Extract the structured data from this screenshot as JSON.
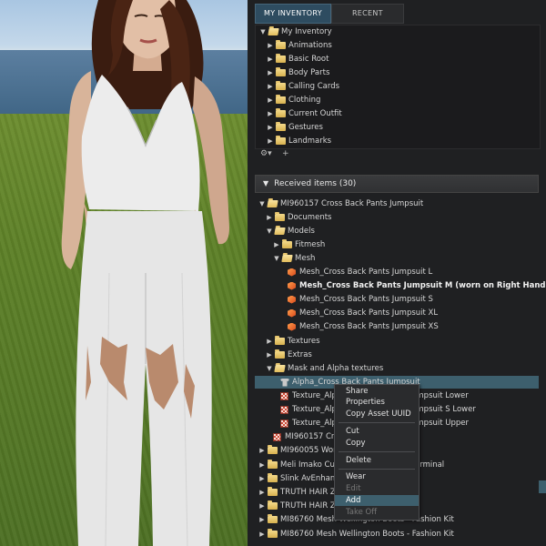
{
  "tabs": {
    "my_inventory": "MY INVENTORY",
    "recent": "RECENT"
  },
  "inventory_tree": [
    {
      "label": "My Inventory",
      "expanded": true
    },
    {
      "label": "Animations"
    },
    {
      "label": "Basic Root"
    },
    {
      "label": "Body Parts"
    },
    {
      "label": "Calling Cards"
    },
    {
      "label": "Clothing"
    },
    {
      "label": "Current Outfit"
    },
    {
      "label": "Gestures"
    },
    {
      "label": "Landmarks"
    }
  ],
  "toolbar": {
    "gear": "⚙▾",
    "add": "+"
  },
  "received": {
    "header": "Received items (30)",
    "rows": [
      {
        "label": "MI960157  Cross Back Pants Jumpsuit"
      },
      {
        "label": "Documents"
      },
      {
        "label": "Models"
      },
      {
        "label": "Fitmesh"
      },
      {
        "label": "Mesh"
      },
      {
        "label": "Mesh_Cross Back Pants Jumpsuit L"
      },
      {
        "label": "Mesh_Cross Back Pants Jumpsuit M (worn on Right Hand"
      },
      {
        "label": "Mesh_Cross Back Pants Jumpsuit S"
      },
      {
        "label": "Mesh_Cross Back Pants Jumpsuit XL"
      },
      {
        "label": "Mesh_Cross Back Pants Jumpsuit XS"
      },
      {
        "label": "Textures"
      },
      {
        "label": "Extras"
      },
      {
        "label": "Mask and Alpha textures"
      },
      {
        "label": "Alpha_Cross Back Pants Jumpsuit"
      },
      {
        "label": "Texture_Alp",
        "tail": "umpsuit Lower"
      },
      {
        "label": "Texture_Alp",
        "tail": "umpsuit S Lower"
      },
      {
        "label": "Texture_Alp",
        "tail": "umpsuit Upper"
      },
      {
        "label": "MI960157  Cr",
        "tail": "it"
      },
      {
        "label": "MI960055 Wom"
      },
      {
        "label": "Meli Imako Cu",
        "tail": "erminal"
      },
      {
        "label": "Slink AvEnhan"
      },
      {
        "label": "TRUTH HAIR Z"
      },
      {
        "label": "TRUTH HAIR Z"
      },
      {
        "label": "MI86760 Mesh Wellington Boots - Fashion Kit"
      },
      {
        "label": "MI86760 Mesh Wellington Boots - Fashion Kit"
      }
    ]
  },
  "context_menu": {
    "share": "Share",
    "properties": "Properties",
    "copy_uuid": "Copy Asset UUID",
    "cut": "Cut",
    "copy": "Copy",
    "delete": "Delete",
    "wear": "Wear",
    "edit": "Edit",
    "add": "Add",
    "take_off": "Take Off"
  }
}
